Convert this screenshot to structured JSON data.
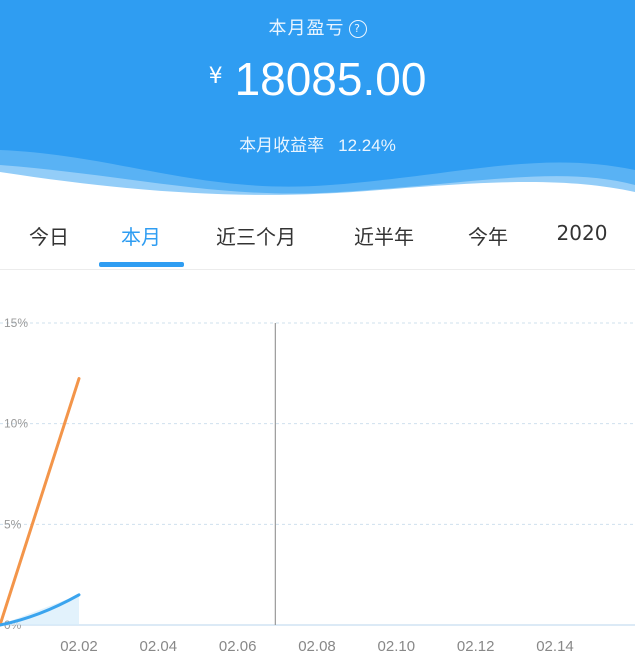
{
  "header": {
    "title": "本月盈亏",
    "help_icon_glyph": "?",
    "currency": "¥",
    "amount": "18085.00",
    "rate_label": "本月收益率",
    "rate_value": "12.24%"
  },
  "tabs": [
    "今日",
    "本月",
    "近三个月",
    "近半年",
    "今年",
    "2020"
  ],
  "active_tab": 1,
  "colors": {
    "primary": "#2f9df2",
    "orange": "#f3954a",
    "blue_line": "#3aa4ee"
  },
  "chart_data": {
    "type": "line",
    "x_ticks": [
      "02.02",
      "02.04",
      "02.06",
      "02.08",
      "02.10",
      "02.12",
      "02.14"
    ],
    "y_ticks": [
      "15%",
      "10%",
      "5%",
      "0%"
    ],
    "ylim": [
      0,
      15
    ],
    "grid": true,
    "series": [
      {
        "color": "#f3954a",
        "x": [
          "02.01",
          "02.02"
        ],
        "values": [
          0,
          12.24
        ]
      },
      {
        "color": "#3aa4ee",
        "x": [
          "02.01",
          "02.02"
        ],
        "values": [
          0,
          1.5
        ]
      }
    ],
    "crosshair_x": "02.07"
  }
}
